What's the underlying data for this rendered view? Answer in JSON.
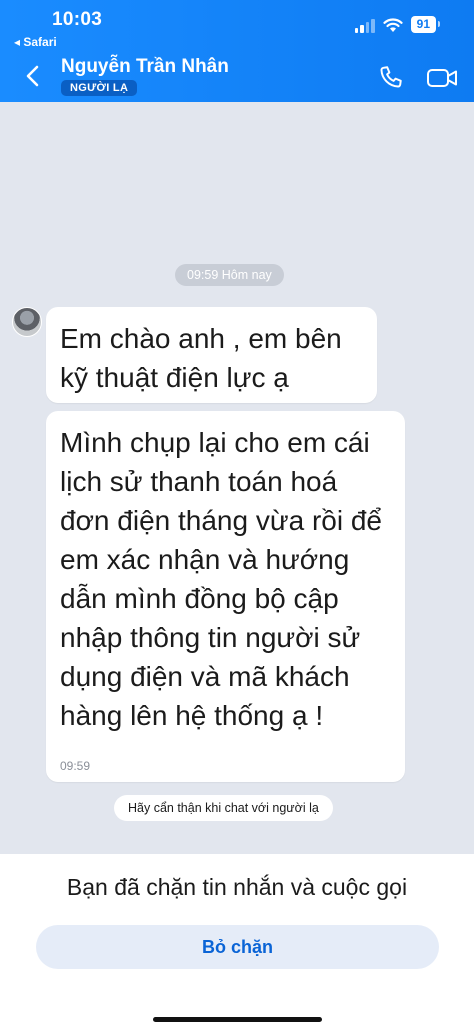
{
  "status_bar": {
    "time": "10:03",
    "back_app": "◂ Safari",
    "battery": "91"
  },
  "header": {
    "contact_name": "Nguyễn Trần Nhân",
    "badge": "NGƯỜI LẠ",
    "icons": [
      "chevron-left-icon",
      "phone-icon",
      "video-camera-icon"
    ]
  },
  "chat": {
    "timestamp_pill": "09:59 Hôm nay",
    "messages": [
      {
        "text": "Em chào anh , em  bên kỹ thuật điện lực ạ"
      },
      {
        "text": "Mình chụp lại cho em cái lịch sử thanh toán hoá đơn điện tháng vừa rồi để em xác nhận và hướng dẫn mình đồng bộ cập nhập thông tin người sử dụng điện và mã khách hàng lên hệ thống ạ !",
        "time": "09:59"
      }
    ],
    "warning": "Hãy cẩn thận khi chat với người lạ"
  },
  "footer": {
    "blocked_notice": "Bạn đã chặn tin nhắn và cuộc gọi",
    "unblock_label": "Bỏ chặn"
  },
  "colors": {
    "header_blue": "#0e7bf2",
    "badge_blue": "#0a5fc4",
    "chat_bg": "#e2e6ee",
    "unblock_text": "#0a64d6"
  }
}
